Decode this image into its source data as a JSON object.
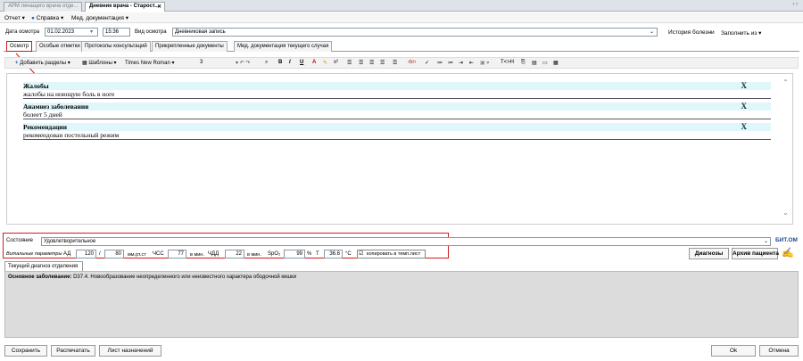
{
  "tabs": [
    {
      "label": "АРМ лечащего врача отде..."
    },
    {
      "label": "Дневник врача - Старост..."
    }
  ],
  "menu": {
    "report": "Отчет",
    "help": "Справка",
    "med_docs": "Мед. документация"
  },
  "form": {
    "date_label": "Дата осмотра",
    "date_value": "01.02.2023",
    "time_value": "15:36",
    "type_label": "Вид осмотра",
    "type_value": "Дневниковая запись",
    "history_button": "История болезни",
    "fill_label": "Заполнить из"
  },
  "subtabs": [
    "Осмотр",
    "Особые отметки",
    "Протоколы консультаций",
    "Прикрепленные документы",
    "Мед. документация текущего случая"
  ],
  "toolbar": {
    "add_sections": "Добавить разделы",
    "templates": "Шаблоны",
    "font": "Times New Roman",
    "size": "3",
    "bold": "B",
    "italic": "I",
    "underline": "U",
    "html": "T<>H"
  },
  "sections": [
    {
      "title": "Жалобы",
      "text": "жалобы на ноющую боль в ноге"
    },
    {
      "title": "Анамнез заболевания",
      "text": "болеет 5 дней"
    },
    {
      "title": "Рекомендации",
      "text": "рекомендован постельный режим"
    }
  ],
  "close_mark": "X",
  "state": {
    "label": "Состояние",
    "value": "Удовлетворительное",
    "logo": "БИТ.ОМ"
  },
  "vitals": {
    "label": "Витальные параметры",
    "ad_label": "АД",
    "ad1": "120",
    "sep": "/",
    "ad2": "80",
    "ad_unit": "мм.рт.ст",
    "hr_label": "ЧСС",
    "hr": "77",
    "hr_unit": "в мин.",
    "rr_label": "ЧДД",
    "rr": "22",
    "rr_unit": "в мин.",
    "spo2_label": "SpO₂",
    "spo2": "99",
    "spo2_unit": "%",
    "t_label": "T",
    "t": "36.6",
    "t_unit": "°C",
    "copy_label": "копировать в темп.лист"
  },
  "buttons": {
    "diagnoses": "Диагнозы",
    "archive": "Архив пациента",
    "save": "Сохранить",
    "print": "Распечатать",
    "prescriptions": "Лист назначений",
    "ok": "Ok",
    "cancel": "Отмена"
  },
  "diagnosis": {
    "tab": "Текущий диагноз отделения",
    "label": "Основное заболевание:",
    "text": "D37.4. Новообразование неопределенного или неизвестного характера ободочной кишки"
  },
  "colors": {
    "accent": "#dff6fb",
    "highlight": "#d21a1a",
    "panel": "#dcdcdc"
  }
}
